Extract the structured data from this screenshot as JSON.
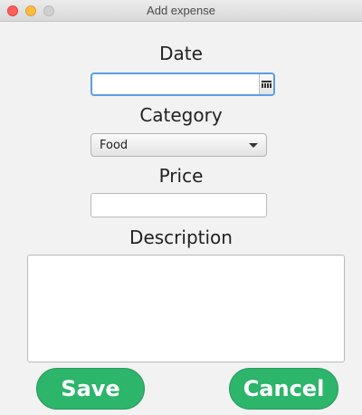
{
  "window": {
    "title": "Add expense"
  },
  "form": {
    "date_label": "Date",
    "date_value": "",
    "category_label": "Category",
    "category_selected": "Food",
    "price_label": "Price",
    "price_value": "",
    "description_label": "Description",
    "description_value": ""
  },
  "actions": {
    "save_label": "Save",
    "cancel_label": "Cancel"
  },
  "colors": {
    "primary_button": "#2db56b",
    "focus_border": "#5a9ee6"
  },
  "icons": {
    "date_picker": "calendar-icon",
    "category_dropdown": "chevron-down-icon"
  }
}
